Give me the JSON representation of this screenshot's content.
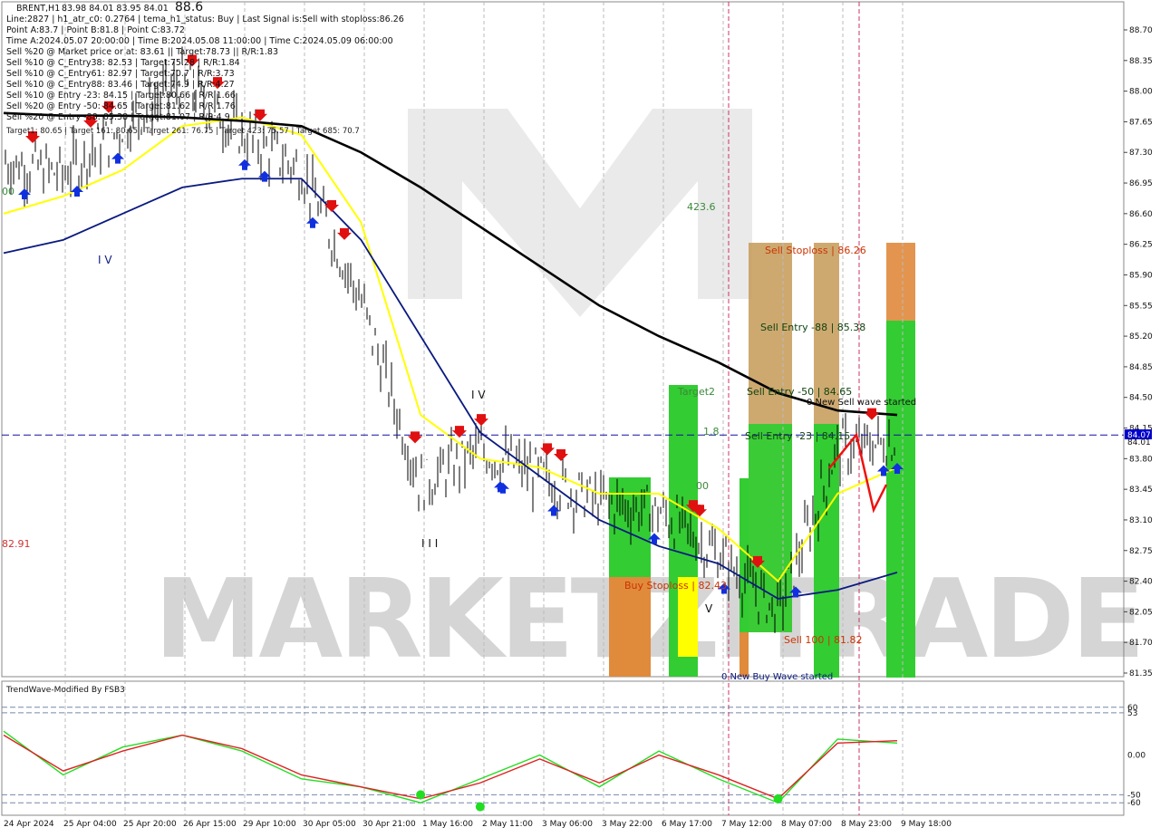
{
  "header": {
    "symbol": "BRENT,H1",
    "ohlc": "83.98 84.01 83.95 84.01",
    "lines": [
      "Line:2827 | h1_atr_c0: 0.2764 | tema_h1_status: Buy | Last Signal is:Sell with stoploss:86.26",
      "Point A:83.7 | Point B:81.8 | Point C:83.72",
      "Time A:2024.05.07 20:00:00 | Time B:2024.05.08 11:00:00 | Time C:2024.05.09 06:00:00",
      "Sell %20 @ Market price or at: 83.61 || Target:78.73 || R/R:1.83",
      "Sell %10 @ C_Entry38: 82.53 | Target:75.28 | R/R:1.84",
      "Sell %10 @ C_Entry61: 82.97 | Target:70.7 | R/R:3.73",
      "Sell %10 @ C_Entry88: 83.46 | Target:74.9 | R/R:4.27",
      "Sell %10 @ Entry -23: 84.15 | Target:80.66 | R/R:1.66",
      "Sell %20 @ Entry -50: 84.65 | Target:81.62 | R/R:1.76",
      "Sell %20 @ Entry -88: 85.38 | Target:81.07 | R/R:4.9"
    ]
  },
  "chart_labels": {
    "top_price": "88.6",
    "level_4236": "423.6",
    "left_value": "00",
    "left_price": "82.91",
    "sell_stoploss": "Sell Stoploss | 86.26",
    "sell_entry_88": "Sell Entry -88 | 85.38",
    "sell_entry_50": "Sell Entry -50 | 84.65",
    "sell_entry_23": "Sell Entry -23 | 84.15",
    "target2": "Target2",
    "new_sell_wave": "0 New Sell wave started",
    "buy_stoploss": "Buy Stoploss | 82.43",
    "sell_target": "Sell 100 | 81.82",
    "new_buy_wave": "0 New Buy Wave started",
    "fib_18": "1.8",
    "fib_00": "00",
    "target1_line": "Target1: 80.65 | Target 161: 80.65 | Target 261: 76.75 | Target 423: 75.57 | Target 685: 70.7",
    "wave_label_a": "I V",
    "wave_label_b": "I I I",
    "wave_label_c": "V",
    "wave_label_d": "I V",
    "current_price_tag": "84.07",
    "current_price_tag2": "84.01",
    "watermark": "MARKETZITRADE"
  },
  "colors": {
    "background": "#ffffff",
    "ema_yellow": "#ffff00",
    "ma_blue": "#0a1a80",
    "ma_black": "#000000",
    "candle": "#000000",
    "sell_arrow": "#e01010",
    "buy_arrow": "#1030e0",
    "zone_green": "#33cc33",
    "zone_orange": "#e08a3c",
    "zone_tan": "#c8a060",
    "price_line": "#1010a0",
    "osc_green": "#22dd22",
    "osc_red": "#dd2222",
    "price_tag_bg": "#0000cc"
  },
  "chart_data": [
    {
      "type": "line",
      "symbol": "BRENT",
      "timeframe": "H1",
      "y_range": [
        81.35,
        88.7
      ],
      "y_ticks": [
        "88.70",
        "88.35",
        "88.00",
        "87.65",
        "87.30",
        "86.95",
        "86.60",
        "86.25",
        "85.90",
        "85.55",
        "85.20",
        "84.85",
        "84.50",
        "84.15",
        "83.80",
        "83.45",
        "83.10",
        "82.75",
        "82.40",
        "82.05",
        "81.70",
        "81.35"
      ],
      "x_ticks": [
        "24 Apr 2024",
        "25 Apr 04:00",
        "25 Apr 20:00",
        "26 Apr 15:00",
        "29 Apr 10:00",
        "30 Apr 05:00",
        "30 Apr 21:00",
        "1 May 16:00",
        "2 May 11:00",
        "3 May 06:00",
        "3 May 22:00",
        "6 May 17:00",
        "7 May 12:00",
        "8 May 07:00",
        "8 May 23:00",
        "9 May 18:00"
      ],
      "series": [
        {
          "x": [
            "24 Apr 2024",
            "25 Apr 04:00",
            "25 Apr 20:00",
            "26 Apr 15:00",
            "29 Apr 10:00",
            "30 Apr 05:00",
            "30 Apr 21:00",
            "1 May 16:00",
            "2 May 11:00",
            "3 May 06:00",
            "3 May 22:00",
            "6 May 17:00",
            "7 May 12:00",
            "8 May 07:00",
            "8 May 23:00",
            "9 May 18:00"
          ],
          "values": [
            87.2,
            87.05,
            87.6,
            88.1,
            87.5,
            87.1,
            85.6,
            83.5,
            83.9,
            83.6,
            83.3,
            83.2,
            82.7,
            82.05,
            83.9,
            84.01
          ]
        },
        {
          "x": [
            "24 Apr 2024",
            "25 Apr 04:00",
            "25 Apr 20:00",
            "26 Apr 15:00",
            "29 Apr 10:00",
            "30 Apr 05:00",
            "30 Apr 21:00",
            "1 May 16:00",
            "2 May 11:00",
            "3 May 06:00",
            "3 May 22:00",
            "6 May 17:00",
            "7 May 12:00",
            "8 May 07:00",
            "8 May 23:00",
            "9 May 18:00"
          ],
          "values": [
            86.6,
            86.8,
            87.1,
            87.6,
            87.7,
            87.5,
            86.5,
            84.3,
            83.8,
            83.7,
            83.4,
            83.4,
            83.0,
            82.4,
            83.4,
            83.7
          ]
        },
        {
          "x": [
            "24 Apr 2024",
            "25 Apr 04:00",
            "25 Apr 20:00",
            "26 Apr 15:00",
            "29 Apr 10:00",
            "30 Apr 05:00",
            "30 Apr 21:00",
            "1 May 16:00",
            "2 May 11:00",
            "3 May 06:00",
            "3 May 22:00",
            "6 May 17:00",
            "7 May 12:00",
            "8 May 07:00",
            "8 May 23:00",
            "9 May 18:00"
          ],
          "values": [
            86.15,
            86.3,
            86.6,
            86.9,
            87.0,
            87.0,
            86.3,
            85.2,
            84.1,
            83.6,
            83.1,
            82.8,
            82.6,
            82.2,
            82.3,
            82.5
          ]
        },
        {
          "x": [
            "24 Apr 2024",
            "25 Apr 04:00",
            "25 Apr 20:00",
            "26 Apr 15:00",
            "29 Apr 10:00",
            "30 Apr 05:00",
            "30 Apr 21:00",
            "1 May 16:00",
            "2 May 11:00",
            "3 May 06:00",
            "3 May 22:00",
            "6 May 17:00",
            "7 May 12:00",
            "8 May 07:00",
            "8 May 23:00",
            "9 May 18:00"
          ],
          "values": [
            87.75,
            87.72,
            87.72,
            87.7,
            87.66,
            87.6,
            87.3,
            86.9,
            86.45,
            86.0,
            85.55,
            85.2,
            84.9,
            84.55,
            84.35,
            84.3
          ]
        }
      ],
      "hlines": [
        {
          "value": 84.07
        },
        {
          "value": 84.01
        }
      ]
    },
    {
      "type": "line",
      "title": "TrendWave-Modified By FSB3",
      "y_range": [
        -70,
        70
      ],
      "y_ticks": [
        "60",
        "53",
        "0.00",
        "-50",
        "-60"
      ],
      "series": [
        {
          "x": [
            "24 Apr 2024",
            "25 Apr 04:00",
            "25 Apr 20:00",
            "26 Apr 15:00",
            "29 Apr 10:00",
            "30 Apr 05:00",
            "30 Apr 21:00",
            "1 May 16:00",
            "2 May 11:00",
            "3 May 06:00",
            "3 May 22:00",
            "6 May 17:00",
            "7 May 12:00",
            "8 May 07:00",
            "8 May 23:00",
            "9 May 18:00"
          ],
          "values": [
            30,
            -25,
            10,
            25,
            5,
            -30,
            -40,
            -60,
            -30,
            0,
            -40,
            5,
            -30,
            -60,
            20,
            15
          ]
        },
        {
          "x": [
            "24 Apr 2024",
            "25 Apr 04:00",
            "25 Apr 20:00",
            "26 Apr 15:00",
            "29 Apr 10:00",
            "30 Apr 05:00",
            "30 Apr 21:00",
            "1 May 16:00",
            "2 May 11:00",
            "3 May 06:00",
            "3 May 22:00",
            "6 May 17:00",
            "7 May 12:00",
            "8 May 07:00",
            "8 May 23:00",
            "9 May 18:00"
          ],
          "values": [
            25,
            -20,
            5,
            25,
            8,
            -25,
            -40,
            -55,
            -35,
            -5,
            -35,
            0,
            -25,
            -55,
            15,
            18
          ]
        }
      ],
      "markers": [
        {
          "x": "1 May 16:00",
          "y": -50
        },
        {
          "x": "2 May 11:00",
          "y": -65
        },
        {
          "x": "8 May 07:00",
          "y": -55
        }
      ]
    }
  ]
}
